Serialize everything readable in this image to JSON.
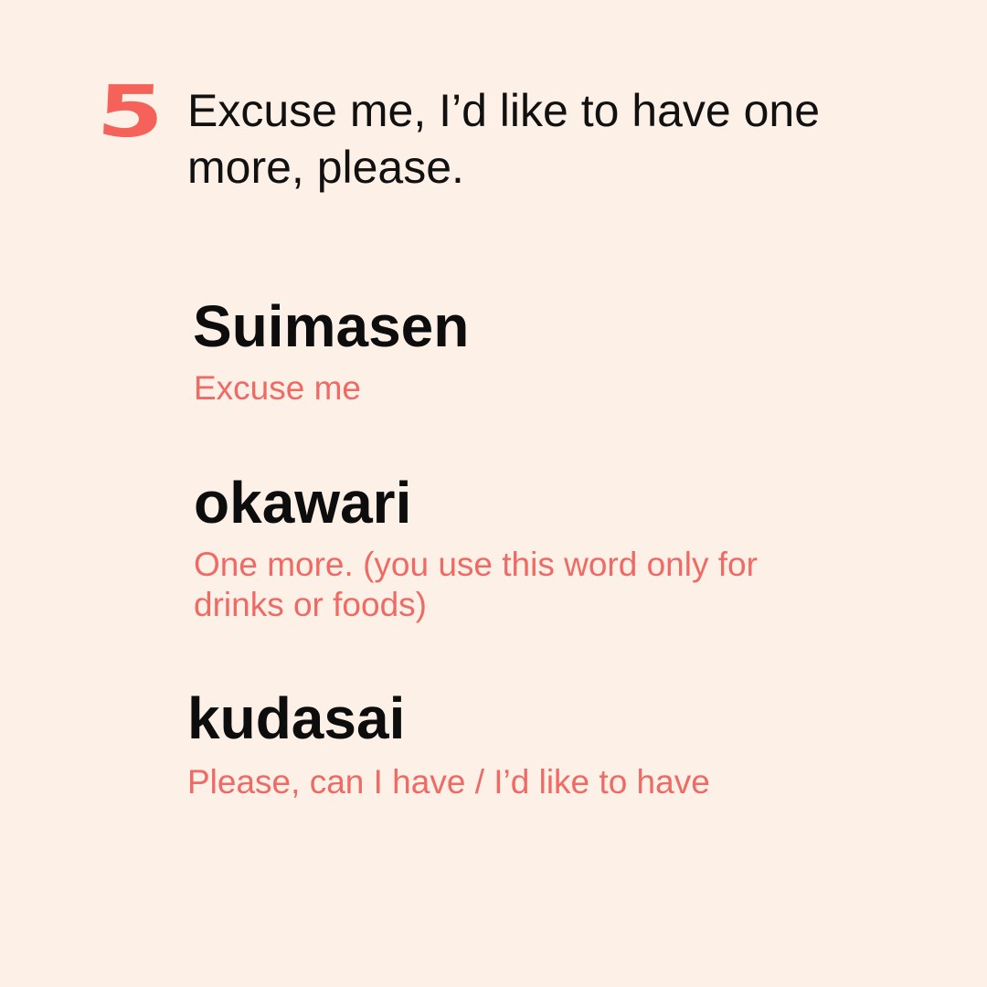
{
  "step_number": "5",
  "headline": "Excuse me, I’d like to have one more, please.",
  "phrases": [
    {
      "term": "Suimasen",
      "meaning": "Excuse me"
    },
    {
      "term": "okawari",
      "meaning": "One more. (you use this word only for drinks or foods)"
    },
    {
      "term": "kudasai",
      "meaning": "Please, can I have / I’d like to have"
    }
  ],
  "colors": {
    "background": "#fdf1e7",
    "accent": "#f4625a",
    "gloss": "#ef6a64",
    "text": "#111111"
  }
}
